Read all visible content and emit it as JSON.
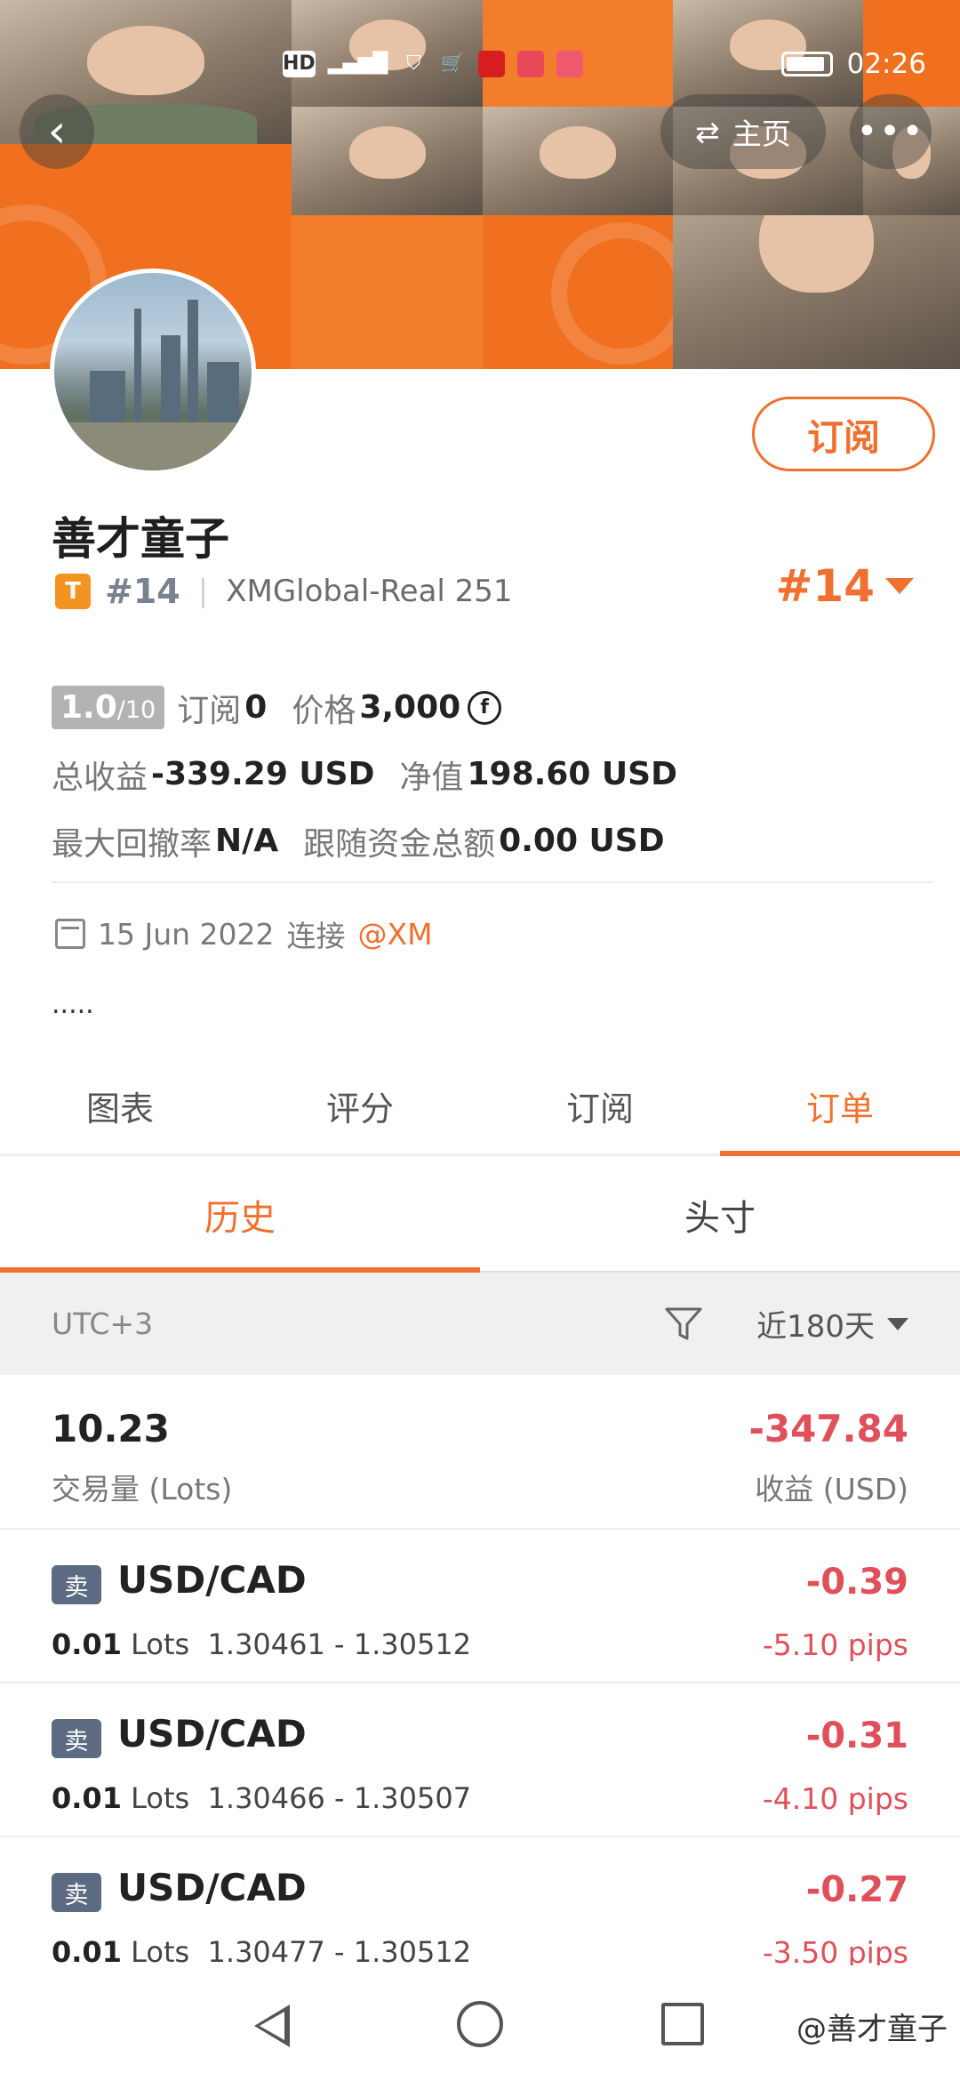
{
  "status_bar": {
    "icons": [
      "HD",
      "5G",
      "signal",
      "shield",
      "cart",
      "app-red",
      "app-huawei",
      "book"
    ],
    "time": "02:26"
  },
  "header": {
    "back_icon": "chevron-left-icon",
    "home_label": "主页",
    "home_icon": "swap-icon",
    "more_icon": "more-dots-icon"
  },
  "profile": {
    "name": "善才童子",
    "tier_badge": "T",
    "rank_small": "#14",
    "account": "XMGlobal-Real 251",
    "rank_big": "#14",
    "subscribe_label": "订阅",
    "score": "1.0",
    "score_max": "/10",
    "subscribers_label": "订阅",
    "subscribers": "0",
    "price_label": "价格",
    "price": "3,000",
    "total_profit_label": "总收益",
    "total_profit": "-339.29 USD",
    "net_value_label": "净值",
    "net_value": "198.60 USD",
    "max_drawdown_label": "最大回撤率",
    "max_drawdown": "N/A",
    "follow_funds_label": "跟随资金总额",
    "follow_funds": "0.00 USD",
    "joined_date": "15 Jun 2022",
    "joined_text": "连接",
    "broker": "@XM",
    "bio": "....."
  },
  "tabs": [
    "图表",
    "评分",
    "订阅",
    "订单"
  ],
  "active_tab": 3,
  "subtabs": [
    "历史",
    "头寸"
  ],
  "active_subtab": 0,
  "filter": {
    "timezone": "UTC+3",
    "period": "近180天"
  },
  "summary": {
    "lots": "10.23",
    "lots_label": "交易量 (Lots)",
    "profit": "-347.84",
    "profit_label": "收益 (USD)"
  },
  "orders": [
    {
      "side": "卖",
      "pair": "USD/CAD",
      "lots": "0.01",
      "lots_unit": "Lots",
      "range": "1.30461 - 1.30512",
      "amount": "-0.39",
      "pips": "-5.10 pips"
    },
    {
      "side": "卖",
      "pair": "USD/CAD",
      "lots": "0.01",
      "lots_unit": "Lots",
      "range": "1.30466 - 1.30507",
      "amount": "-0.31",
      "pips": "-4.10 pips"
    },
    {
      "side": "卖",
      "pair": "USD/CAD",
      "lots": "0.01",
      "lots_unit": "Lots",
      "range": "1.30477 - 1.30512",
      "amount": "-0.27",
      "pips": "-3.50 pips"
    }
  ],
  "watermark": "@善才童子",
  "colors": {
    "accent": "#f07030",
    "negative": "#e0505a",
    "sell_tag": "#5c6a82"
  }
}
